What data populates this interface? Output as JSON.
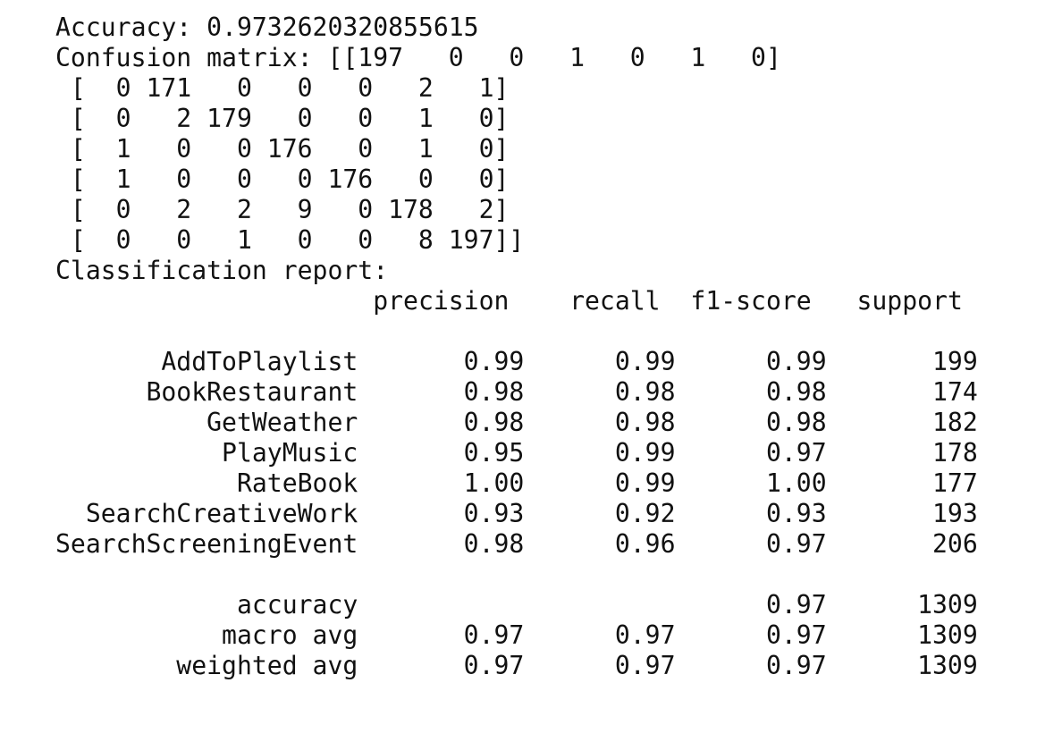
{
  "accuracy_line": "Accuracy: 0.9732620320855615",
  "confusion_matrix": {
    "label": "Confusion matrix:",
    "rows": [
      "[[197   0   0   1   0   1   0]",
      " [  0 171   0   0   0   2   1]",
      " [  0   2 179   0   0   1   0]",
      " [  1   0   0 176   0   1   0]",
      " [  1   0   0   0 176   0   0]",
      " [  0   2   2   9   0 178   2]",
      " [  0   0   1   0   0   8 197]]"
    ]
  },
  "classification_report": {
    "title": "Classification report:",
    "headers": [
      "precision",
      "recall",
      "f1-score",
      "support"
    ],
    "classes": [
      {
        "name": "AddToPlaylist",
        "precision": "0.99",
        "recall": "0.99",
        "f1": "0.99",
        "support": "199"
      },
      {
        "name": "BookRestaurant",
        "precision": "0.98",
        "recall": "0.98",
        "f1": "0.98",
        "support": "174"
      },
      {
        "name": "GetWeather",
        "precision": "0.98",
        "recall": "0.98",
        "f1": "0.98",
        "support": "182"
      },
      {
        "name": "PlayMusic",
        "precision": "0.95",
        "recall": "0.99",
        "f1": "0.97",
        "support": "178"
      },
      {
        "name": "RateBook",
        "precision": "1.00",
        "recall": "0.99",
        "f1": "1.00",
        "support": "177"
      },
      {
        "name": "SearchCreativeWork",
        "precision": "0.93",
        "recall": "0.92",
        "f1": "0.93",
        "support": "193"
      },
      {
        "name": "SearchScreeningEvent",
        "precision": "0.98",
        "recall": "0.96",
        "f1": "0.97",
        "support": "206"
      }
    ],
    "summary": [
      {
        "name": "accuracy",
        "precision": "",
        "recall": "",
        "f1": "0.97",
        "support": "1309"
      },
      {
        "name": "macro avg",
        "precision": "0.97",
        "recall": "0.97",
        "f1": "0.97",
        "support": "1309"
      },
      {
        "name": "weighted avg",
        "precision": "0.97",
        "recall": "0.97",
        "f1": "0.97",
        "support": "1309"
      }
    ]
  }
}
